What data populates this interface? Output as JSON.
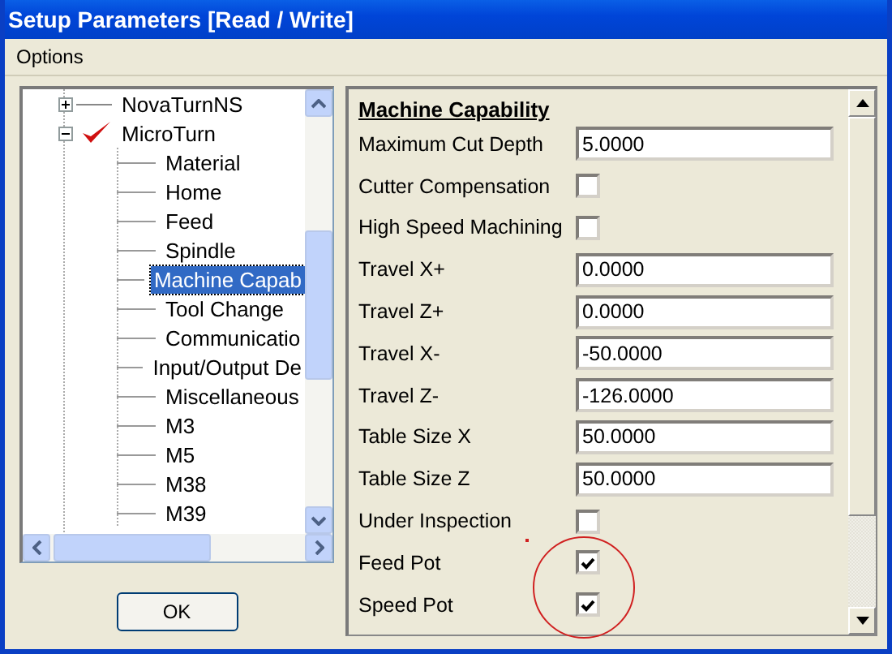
{
  "window": {
    "title": "Setup Parameters [Read / Write]"
  },
  "menu": [
    "Options"
  ],
  "tree": [
    {
      "label": "NovaTurnNS",
      "expanded": false,
      "checked": false
    },
    {
      "label": "MicroTurn",
      "expanded": true,
      "checked": true,
      "children": [
        {
          "label": "Material",
          "selected": false
        },
        {
          "label": "Home",
          "selected": false
        },
        {
          "label": "Feed",
          "selected": false
        },
        {
          "label": "Spindle",
          "selected": false
        },
        {
          "label": "Machine Capab",
          "selected": true
        },
        {
          "label": "Tool Change",
          "selected": false
        },
        {
          "label": "Communicatio",
          "selected": false
        },
        {
          "label": "Input/Output De",
          "selected": false
        },
        {
          "label": "Miscellaneous",
          "selected": false
        },
        {
          "label": "M3",
          "selected": false
        },
        {
          "label": "M5",
          "selected": false
        },
        {
          "label": "M38",
          "selected": false
        },
        {
          "label": "M39",
          "selected": false
        }
      ]
    }
  ],
  "ok_button": "OK",
  "panel": {
    "heading": "Machine Capability",
    "rows": [
      {
        "kind": "field",
        "label": "Maximum Cut Depth",
        "value": "5.0000"
      },
      {
        "kind": "checkbox",
        "label": "Cutter Compensation",
        "checked": false
      },
      {
        "kind": "checkbox",
        "label": "High Speed Machining",
        "checked": false
      },
      {
        "kind": "field",
        "label": "Travel X+",
        "value": "0.0000"
      },
      {
        "kind": "field",
        "label": "Travel Z+",
        "value": "0.0000"
      },
      {
        "kind": "field",
        "label": "Travel X-",
        "value": "-50.0000"
      },
      {
        "kind": "field",
        "label": "Travel Z-",
        "value": "-126.0000"
      },
      {
        "kind": "field",
        "label": "Table Size X",
        "value": "50.0000"
      },
      {
        "kind": "field",
        "label": "Table Size Z",
        "value": "50.0000"
      },
      {
        "kind": "checkbox",
        "label": "Under Inspection",
        "checked": false
      },
      {
        "kind": "checkbox",
        "label": "Feed Pot",
        "checked": true
      },
      {
        "kind": "checkbox",
        "label": "Speed Pot",
        "checked": true
      }
    ]
  }
}
